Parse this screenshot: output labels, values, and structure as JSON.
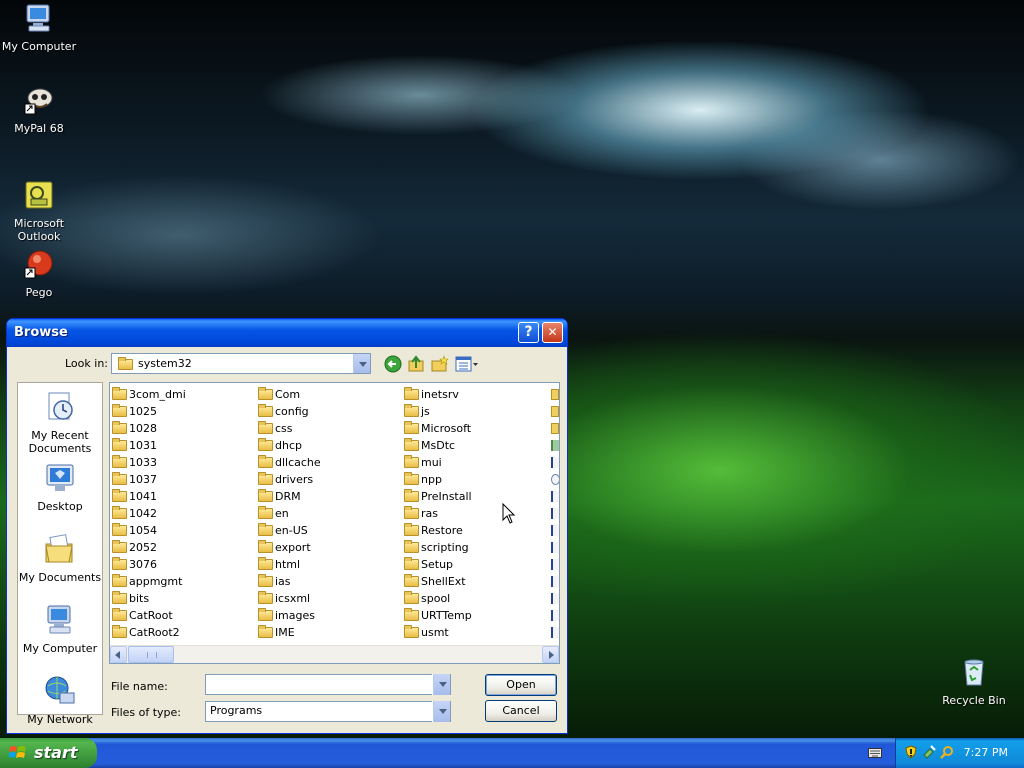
{
  "desktop": {
    "icons": [
      {
        "label": "My Computer",
        "icon": "my-computer-icon"
      },
      {
        "label": "MyPal 68",
        "icon": "mypal-browser-icon"
      },
      {
        "label": "Microsoft\nOutlook",
        "icon": "outlook-icon"
      },
      {
        "label": "Pego",
        "icon": "pego-icon"
      },
      {
        "label": "Recycle Bin",
        "icon": "recycle-bin-icon"
      }
    ]
  },
  "dialog": {
    "title": "Browse",
    "look_in_label": "Look in:",
    "look_in_value": "system32",
    "places": [
      {
        "label": "My Recent Documents",
        "icon": "recent-documents-icon"
      },
      {
        "label": "Desktop",
        "icon": "desktop-icon"
      },
      {
        "label": "My Documents",
        "icon": "my-documents-icon"
      },
      {
        "label": "My Computer",
        "icon": "my-computer-icon"
      },
      {
        "label": "My Network",
        "icon": "my-network-icon"
      }
    ],
    "columns": [
      [
        "3com_dmi",
        "1025",
        "1028",
        "1031",
        "1033",
        "1037",
        "1041",
        "1042",
        "1054",
        "2052",
        "3076",
        "appmgmt",
        "bits",
        "CatRoot",
        "CatRoot2"
      ],
      [
        "Com",
        "config",
        "css",
        "dhcp",
        "dllcache",
        "drivers",
        "DRM",
        "en",
        "en-US",
        "export",
        "html",
        "ias",
        "icsxml",
        "images",
        "IME"
      ],
      [
        "inetsrv",
        "js",
        "Microsoft",
        "MsDtc",
        "mui",
        "npp",
        "PreInstall",
        "ras",
        "Restore",
        "scripting",
        "Setup",
        "ShellExt",
        "spool",
        "URTTemp",
        "usmt"
      ]
    ],
    "file_name_label": "File name:",
    "file_name_value": "",
    "files_of_type_label": "Files of type:",
    "files_of_type_value": "Programs",
    "open_label": "Open",
    "cancel_label": "Cancel",
    "help_label": "?",
    "close_label": "✕"
  },
  "taskbar": {
    "start_label": "start",
    "clock": "7:27 PM"
  }
}
